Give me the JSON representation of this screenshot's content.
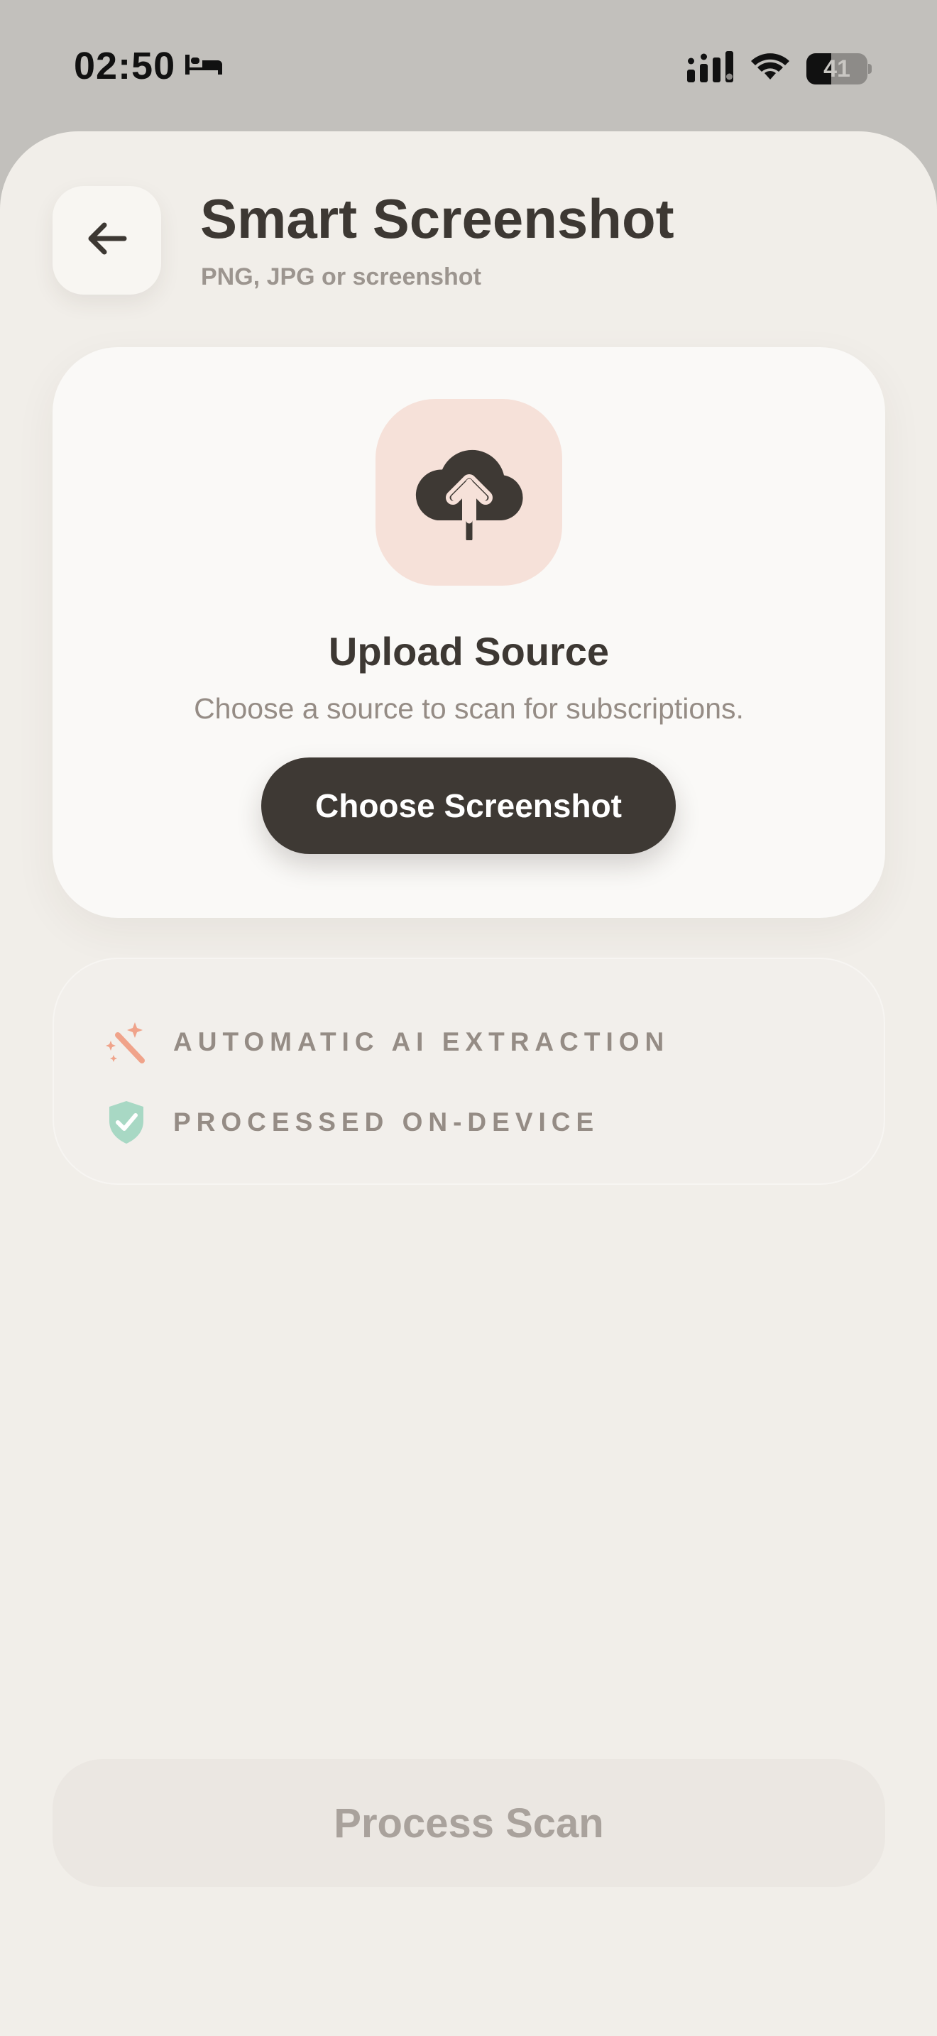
{
  "status_bar": {
    "time": "02:50",
    "battery": "41",
    "battery_level": 0.41,
    "icons": [
      "bed-icon",
      "signal-icon",
      "wifi-icon",
      "battery-icon"
    ]
  },
  "header": {
    "back_icon": "arrow-left-icon",
    "title": "Smart Screenshot",
    "subtitle": "PNG, JPG or screenshot"
  },
  "upload_card": {
    "icon": "cloud-upload-icon",
    "title": "Upload Source",
    "description": "Choose a source to scan for subscriptions.",
    "button_label": "Choose Screenshot"
  },
  "features": {
    "items": [
      {
        "icon": "magic-wand-icon",
        "label": "AUTOMATIC AI EXTRACTION"
      },
      {
        "icon": "shield-check-icon",
        "label": "PROCESSED ON-DEVICE"
      }
    ]
  },
  "footer": {
    "process_label": "Process Scan"
  },
  "colors": {
    "background": "#f1eee9",
    "primary_button": "#3e3934",
    "accent_peach": "#f6e1d9",
    "accent_coral": "#f0a38a",
    "accent_mint": "#a8d8c4",
    "text_dark": "#3d3833",
    "text_muted": "#958c85"
  }
}
